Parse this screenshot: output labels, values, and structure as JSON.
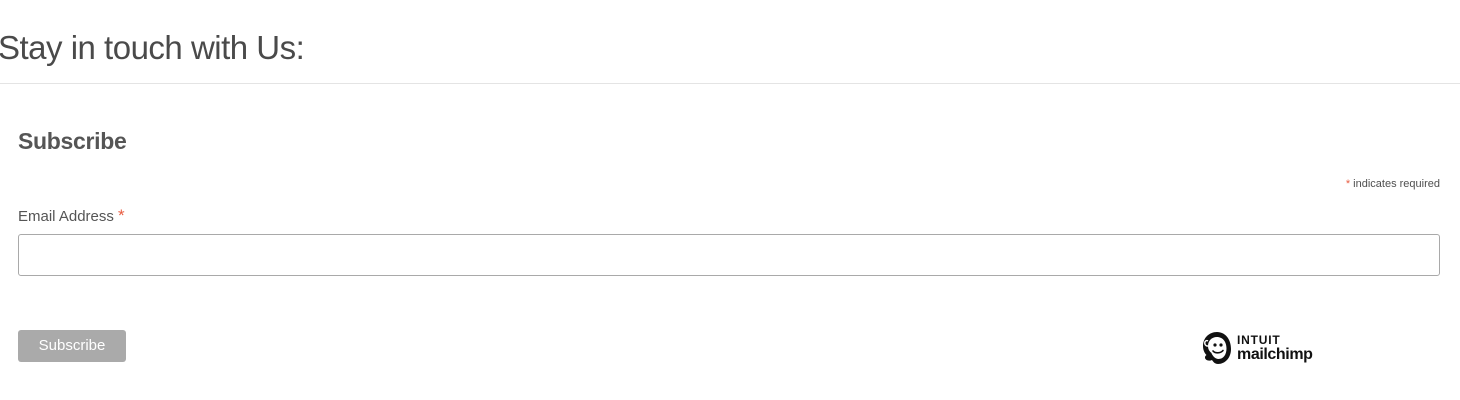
{
  "section": {
    "heading": "Stay in touch with Us:"
  },
  "form": {
    "title": "Subscribe",
    "required_marker": "*",
    "required_note": "indicates required",
    "email": {
      "label": "Email Address",
      "required_marker": "*",
      "value": "",
      "placeholder": ""
    },
    "submit_label": "Subscribe"
  },
  "badge": {
    "line1": "INTUIT",
    "line2": "mailchimp",
    "icon": "mailchimp-freddie-icon"
  },
  "colors": {
    "required_asterisk": "#e85c41",
    "button_background": "#aaaaaa",
    "text": "#555555"
  }
}
